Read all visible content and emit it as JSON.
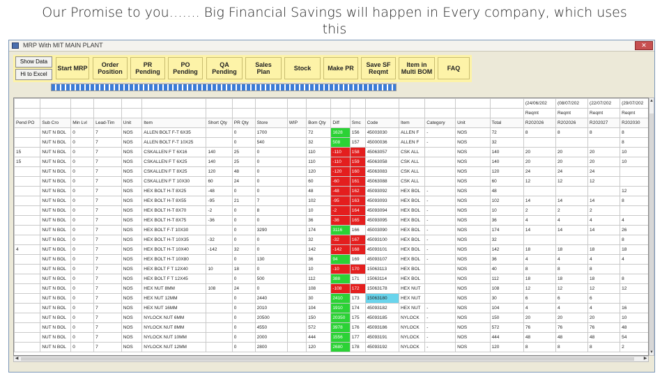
{
  "slide": {
    "title": "Our Promise to you……. Big Financial Savings will happen in Every company, which uses this"
  },
  "window": {
    "title": "MRP With MIT MAIN PLANT",
    "close_icon": "close-icon"
  },
  "toolbar": {
    "show_data": "Show Data",
    "to_excel": "Hi to Excel",
    "buttons": [
      "Start MRP",
      "Order\nPosition",
      "PR\nPending",
      "PO\nPending",
      "QA\nPending",
      "Sales\nPlan",
      "Stock",
      "Make PR",
      "Save SF\nReqmt",
      "Item in\nMulti BOM",
      "FAQ"
    ],
    "bg_color": "#fdf3a8"
  },
  "progress": {
    "percent": 100,
    "color": "#3b7bd6"
  },
  "grid": {
    "date_headers": [
      "(24/06/202",
      "(08/07/202",
      "(22/07/202",
      "(29/07/202"
    ],
    "sub_headers": [
      "Reqmt",
      "Reqmt",
      "Reqmt",
      "Reqmt"
    ],
    "code_headers": [
      "R202026",
      "R202026",
      "R202027",
      "R202030"
    ],
    "columns": [
      "Pend PO",
      "Sub Cro",
      "Min Lvl",
      "Lead-Tim",
      "Unit",
      "Item",
      "Short Qty",
      "PR Qty",
      "Store",
      "WIP",
      "Bom Qty",
      "Diff",
      "Smc",
      "Code",
      "Item",
      "Category",
      "Unit",
      "Total"
    ],
    "rows": [
      {
        "pend": "",
        "sub": "NUT N BOL",
        "min": "0",
        "lead": "7",
        "unit": "NOS",
        "item": "ALLEN BOLT F-T 6X35",
        "short": "",
        "prqty": "0",
        "store": "1700",
        "wip": "",
        "bom": "72",
        "diff": "1628",
        "diff_color": "green",
        "smc": "156",
        "smc_color": "",
        "code": "45003030",
        "code_color": "",
        "item2": "ALLEN F",
        "cat": "-",
        "unit2": "NOS",
        "total": "72",
        "r1": "8",
        "r2": "8",
        "r3": "8",
        "r4": "8"
      },
      {
        "pend": "",
        "sub": "NUT N BOL",
        "min": "0",
        "lead": "7",
        "unit": "NOS",
        "item": "ALLEN BOLT F-T 10X25",
        "short": "",
        "prqty": "0",
        "store": "540",
        "wip": "",
        "bom": "32",
        "diff": "508",
        "diff_color": "green",
        "smc": "157",
        "smc_color": "",
        "code": "45000036",
        "code_color": "",
        "item2": "ALLEN F",
        "cat": "-",
        "unit2": "NOS",
        "total": "32",
        "r1": "",
        "r2": "",
        "r3": "",
        "r4": "8"
      },
      {
        "pend": "15",
        "sub": "NUT N BOL",
        "min": "0",
        "lead": "7",
        "unit": "NOS",
        "item": "CSKALLEN F T 6X16",
        "short": "140",
        "prqty": "25",
        "store": "0",
        "wip": "",
        "bom": "110",
        "diff": "-110",
        "diff_color": "red",
        "smc": "158",
        "smc_color": "red",
        "code": "45063057",
        "code_color": "",
        "item2": "CSK ALL",
        "cat": "",
        "unit2": "NOS",
        "total": "140",
        "r1": "20",
        "r2": "20",
        "r3": "20",
        "r4": "10"
      },
      {
        "pend": "15",
        "sub": "NUT N BOL",
        "min": "0",
        "lead": "7",
        "unit": "NOS",
        "item": "CSKALLEN F T 6X25",
        "short": "140",
        "prqty": "25",
        "store": "0",
        "wip": "",
        "bom": "110",
        "diff": "-110",
        "diff_color": "red",
        "smc": "159",
        "smc_color": "red",
        "code": "45063058",
        "code_color": "",
        "item2": "CSK ALL",
        "cat": "",
        "unit2": "NOS",
        "total": "140",
        "r1": "20",
        "r2": "20",
        "r3": "20",
        "r4": "10"
      },
      {
        "pend": "",
        "sub": "NUT N BOL",
        "min": "0",
        "lead": "7",
        "unit": "NOS",
        "item": "CSKALLEN F T 8X25",
        "short": "120",
        "prqty": "48",
        "store": "0",
        "wip": "",
        "bom": "120",
        "diff": "-120",
        "diff_color": "red",
        "smc": "160",
        "smc_color": "red",
        "code": "45063083",
        "code_color": "",
        "item2": "CSK ALL",
        "cat": "",
        "unit2": "NOS",
        "total": "120",
        "r1": "24",
        "r2": "24",
        "r3": "24",
        "r4": ""
      },
      {
        "pend": "",
        "sub": "NUT N BOL",
        "min": "0",
        "lead": "7",
        "unit": "NOS",
        "item": "CSKALLEN F T 10X30",
        "short": "60",
        "prqty": "24",
        "store": "0",
        "wip": "",
        "bom": "60",
        "diff": "-60",
        "diff_color": "red",
        "smc": "161",
        "smc_color": "red",
        "code": "45063088",
        "code_color": "",
        "item2": "CSK ALL",
        "cat": "",
        "unit2": "NOS",
        "total": "60",
        "r1": "12",
        "r2": "12",
        "r3": "12",
        "r4": ""
      },
      {
        "pend": "",
        "sub": "NUT N BOL",
        "min": "0",
        "lead": "7",
        "unit": "NOS",
        "item": "HEX BOLT H-T 8X25",
        "short": "-48",
        "prqty": "0",
        "store": "0",
        "wip": "",
        "bom": "48",
        "diff": "-48",
        "diff_color": "red",
        "smc": "162",
        "smc_color": "red",
        "code": "45093092",
        "code_color": "",
        "item2": "HEX BOL",
        "cat": "-",
        "unit2": "NOS",
        "total": "48",
        "r1": "",
        "r2": "",
        "r3": "",
        "r4": "12"
      },
      {
        "pend": "",
        "sub": "NUT N BOL",
        "min": "0",
        "lead": "7",
        "unit": "NOS",
        "item": "HEX BOLT H-T 8X55",
        "short": "-95",
        "prqty": "21",
        "store": "7",
        "wip": "",
        "bom": "102",
        "diff": "-95",
        "diff_color": "red",
        "smc": "163",
        "smc_color": "red",
        "code": "45093093",
        "code_color": "",
        "item2": "HEX BOL",
        "cat": "-",
        "unit2": "NOS",
        "total": "102",
        "r1": "14",
        "r2": "14",
        "r3": "14",
        "r4": "8"
      },
      {
        "pend": "",
        "sub": "NUT N BOL",
        "min": "0",
        "lead": "7",
        "unit": "NOS",
        "item": "HEX BOLT H-T 8X70",
        "short": "-2",
        "prqty": "0",
        "store": "8",
        "wip": "",
        "bom": "10",
        "diff": "-2",
        "diff_color": "red",
        "smc": "164",
        "smc_color": "red",
        "code": "45093094",
        "code_color": "",
        "item2": "HEX BOL",
        "cat": "-",
        "unit2": "NOS",
        "total": "10",
        "r1": "2",
        "r2": "2",
        "r3": "2",
        "r4": ""
      },
      {
        "pend": "",
        "sub": "NUT N BOL",
        "min": "0",
        "lead": "7",
        "unit": "NOS",
        "item": "HEX BOLT H-T 8X75",
        "short": "-36",
        "prqty": "0",
        "store": "0",
        "wip": "",
        "bom": "36",
        "diff": "-36",
        "diff_color": "red",
        "smc": "165",
        "smc_color": "red",
        "code": "45093095",
        "code_color": "",
        "item2": "HEX BOL",
        "cat": "-",
        "unit2": "NOS",
        "total": "36",
        "r1": "4",
        "r2": "4",
        "r3": "4",
        "r4": "4"
      },
      {
        "pend": "",
        "sub": "NUT N BOL",
        "min": "0",
        "lead": "7",
        "unit": "NOS",
        "item": "HEX BOLT F-T 10X30",
        "short": "",
        "prqty": "0",
        "store": "3290",
        "wip": "",
        "bom": "174",
        "diff": "3116",
        "diff_color": "green",
        "smc": "166",
        "smc_color": "",
        "code": "45003090",
        "code_color": "",
        "item2": "HEX BOL",
        "cat": "-",
        "unit2": "NOS",
        "total": "174",
        "r1": "14",
        "r2": "14",
        "r3": "14",
        "r4": "26"
      },
      {
        "pend": "",
        "sub": "NUT N BOL",
        "min": "0",
        "lead": "7",
        "unit": "NOS",
        "item": "HEX BOLT H-T 10X35",
        "short": "-32",
        "prqty": "0",
        "store": "0",
        "wip": "",
        "bom": "32",
        "diff": "-32",
        "diff_color": "red",
        "smc": "167",
        "smc_color": "red",
        "code": "45093100",
        "code_color": "",
        "item2": "HEX BOL",
        "cat": "-",
        "unit2": "NOS",
        "total": "32",
        "r1": "",
        "r2": "",
        "r3": "",
        "r4": "8"
      },
      {
        "pend": "4",
        "sub": "NUT N BOL",
        "min": "0",
        "lead": "7",
        "unit": "NOS",
        "item": "HEX BOLT H-T 10X40",
        "short": "-142",
        "prqty": "32",
        "store": "0",
        "wip": "",
        "bom": "142",
        "diff": "-142",
        "diff_color": "red",
        "smc": "168",
        "smc_color": "red",
        "code": "45093101",
        "code_color": "",
        "item2": "HEX BOL",
        "cat": "-",
        "unit2": "NOS",
        "total": "142",
        "r1": "18",
        "r2": "18",
        "r3": "18",
        "r4": "18"
      },
      {
        "pend": "",
        "sub": "NUT N BOL",
        "min": "0",
        "lead": "7",
        "unit": "NOS",
        "item": "HEX BOLT H-T 10X80",
        "short": "",
        "prqty": "0",
        "store": "130",
        "wip": "",
        "bom": "36",
        "diff": "94",
        "diff_color": "green",
        "smc": "169",
        "smc_color": "",
        "code": "45093107",
        "code_color": "",
        "item2": "HEX BOL",
        "cat": "-",
        "unit2": "NOS",
        "total": "36",
        "r1": "4",
        "r2": "4",
        "r3": "4",
        "r4": "4"
      },
      {
        "pend": "",
        "sub": "NUT N BOL",
        "min": "0",
        "lead": "7",
        "unit": "NOS",
        "item": "HEX BOLT F T 12X40",
        "short": "10",
        "prqty": "18",
        "store": "0",
        "wip": "",
        "bom": "10",
        "diff": "-10",
        "diff_color": "red",
        "smc": "170",
        "smc_color": "red",
        "code": "15063113",
        "code_color": "",
        "item2": "HEX BOL",
        "cat": "",
        "unit2": "NOS",
        "total": "40",
        "r1": "8",
        "r2": "8",
        "r3": "8",
        "r4": ""
      },
      {
        "pend": "",
        "sub": "NUT N BOL",
        "min": "0",
        "lead": "7",
        "unit": "NOS",
        "item": "HEX BOLT F T 12X45",
        "short": "",
        "prqty": "0",
        "store": "500",
        "wip": "",
        "bom": "112",
        "diff": "388",
        "diff_color": "green",
        "smc": "171",
        "smc_color": "",
        "code": "15063114",
        "code_color": "",
        "item2": "HEX BOL",
        "cat": "",
        "unit2": "NOS",
        "total": "112",
        "r1": "18",
        "r2": "18",
        "r3": "18",
        "r4": "8"
      },
      {
        "pend": "",
        "sub": "NUT N BOL",
        "min": "0",
        "lead": "7",
        "unit": "NOS",
        "item": "HEX NUT 8MM",
        "short": "108",
        "prqty": "24",
        "store": "0",
        "wip": "",
        "bom": "108",
        "diff": "-108",
        "diff_color": "red",
        "smc": "172",
        "smc_color": "red",
        "code": "15063178",
        "code_color": "",
        "item2": "HEX NUT",
        "cat": "",
        "unit2": "NOS",
        "total": "108",
        "r1": "12",
        "r2": "12",
        "r3": "12",
        "r4": "12"
      },
      {
        "pend": "",
        "sub": "NUT N BOL",
        "min": "0",
        "lead": "7",
        "unit": "NOS",
        "item": "HEX NUT 12MM",
        "short": "",
        "prqty": "0",
        "store": "2440",
        "wip": "",
        "bom": "30",
        "diff": "2410",
        "diff_color": "green",
        "smc": "173",
        "smc_color": "",
        "code": "15063180",
        "code_color": "cyan",
        "item2": "HEX NUT",
        "cat": "",
        "unit2": "NOS",
        "total": "30",
        "r1": "6",
        "r2": "6",
        "r3": "6",
        "r4": ""
      },
      {
        "pend": "",
        "sub": "NUT N BOL",
        "min": "0",
        "lead": "7",
        "unit": "NOS",
        "item": "HEX NUT 16MM",
        "short": "",
        "prqty": "0",
        "store": "2010",
        "wip": "",
        "bom": "104",
        "diff": "1910",
        "diff_color": "green",
        "smc": "174",
        "smc_color": "",
        "code": "45093182",
        "code_color": "",
        "item2": "HEX NUT",
        "cat": "-",
        "unit2": "NOS",
        "total": "104",
        "r1": "4",
        "r2": "4",
        "r3": "4",
        "r4": "16"
      },
      {
        "pend": "",
        "sub": "NUT N BOL",
        "min": "0",
        "lead": "7",
        "unit": "NOS",
        "item": "NYLOCK NUT 6MM",
        "short": "",
        "prqty": "0",
        "store": "20500",
        "wip": "",
        "bom": "150",
        "diff": "20350",
        "diff_color": "green",
        "smc": "175",
        "smc_color": "",
        "code": "45093185",
        "code_color": "",
        "item2": "NYLOCK",
        "cat": "-",
        "unit2": "NOS",
        "total": "150",
        "r1": "20",
        "r2": "20",
        "r3": "20",
        "r4": "10"
      },
      {
        "pend": "",
        "sub": "NUT N BOL",
        "min": "0",
        "lead": "7",
        "unit": "NOS",
        "item": "NYLOCK NUT 8MM",
        "short": "",
        "prqty": "0",
        "store": "4550",
        "wip": "",
        "bom": "572",
        "diff": "3978",
        "diff_color": "green",
        "smc": "176",
        "smc_color": "",
        "code": "45093186",
        "code_color": "",
        "item2": "NYLOCK",
        "cat": "-",
        "unit2": "NOS",
        "total": "572",
        "r1": "76",
        "r2": "76",
        "r3": "76",
        "r4": "48"
      },
      {
        "pend": "",
        "sub": "NUT N BOL",
        "min": "0",
        "lead": "7",
        "unit": "NOS",
        "item": "NYLOCK NUT 10MM",
        "short": "",
        "prqty": "0",
        "store": "2000",
        "wip": "",
        "bom": "444",
        "diff": "1556",
        "diff_color": "green",
        "smc": "177",
        "smc_color": "",
        "code": "45093191",
        "code_color": "",
        "item2": "NYLOCK",
        "cat": "-",
        "unit2": "NOS",
        "total": "444",
        "r1": "48",
        "r2": "48",
        "r3": "48",
        "r4": "54"
      },
      {
        "pend": "",
        "sub": "NUT N BOL",
        "min": "0",
        "lead": "7",
        "unit": "NOS",
        "item": "NYLOCK NUT 12MM",
        "short": "",
        "prqty": "0",
        "store": "2800",
        "wip": "",
        "bom": "120",
        "diff": "2680",
        "diff_color": "green",
        "smc": "178",
        "smc_color": "",
        "code": "45093192",
        "code_color": "",
        "item2": "NYLOCK",
        "cat": "-",
        "unit2": "NOS",
        "total": "120",
        "r1": "8",
        "r2": "8",
        "r3": "8",
        "r4": "2"
      }
    ]
  }
}
